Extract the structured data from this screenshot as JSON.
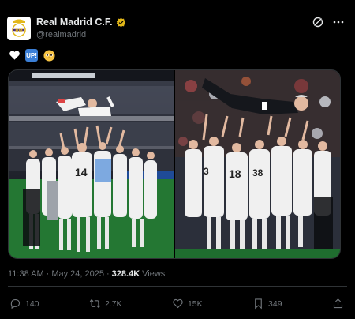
{
  "account": {
    "display_name": "Real Madrid C.F.",
    "handle": "@realmadrid",
    "verified_badge": "gold-check-icon",
    "avatar": "real-madrid-crest"
  },
  "header_actions": [
    "grok-icon",
    "more-icon"
  ],
  "post": {
    "emojis": [
      {
        "name": "white-heart-icon",
        "glyph": "🤍"
      },
      {
        "name": "up-button-icon",
        "glyph": "UP!"
      },
      {
        "name": "holding-back-tears-face-icon",
        "glyph": "🥹"
      }
    ],
    "media": [
      {
        "name": "photo-players-tossing-player"
      },
      {
        "name": "photo-players-tossing-coach"
      }
    ]
  },
  "meta": {
    "time": "11:38 AM",
    "separator": "·",
    "date": "May 24, 2025",
    "views_count": "328.4K",
    "views_label": "Views"
  },
  "actions": {
    "replies": "140",
    "reposts": "2.7K",
    "likes": "15K",
    "bookmarks": "349"
  },
  "colors": {
    "background": "#000000",
    "text_primary": "#e7e9ea",
    "text_secondary": "#71767b",
    "border": "#2f3336",
    "verified_gold": "#e2b719"
  }
}
